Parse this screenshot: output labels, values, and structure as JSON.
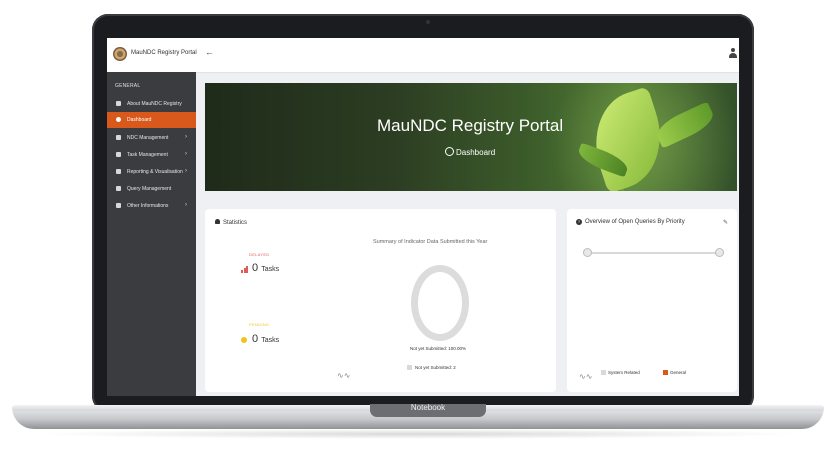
{
  "app": {
    "title": "MauNDC Registry Portal"
  },
  "topbar": {
    "back_icon": "arrow-left-icon",
    "user_icon": "user-icon"
  },
  "sidebar": {
    "section": "GENERAL",
    "items": [
      {
        "label": "About MauNDC Registry",
        "icon": "info-icon",
        "active": false,
        "chevron": ""
      },
      {
        "label": "Dashboard",
        "icon": "dashboard-icon",
        "active": true,
        "chevron": ""
      },
      {
        "label": "NDC Management",
        "icon": "document-icon",
        "active": false,
        "chevron": "›"
      },
      {
        "label": "Task Management",
        "icon": "grid-icon",
        "active": false,
        "chevron": "›"
      },
      {
        "label": "Reporting & Visualisation",
        "icon": "report-icon",
        "active": false,
        "chevron": "›"
      },
      {
        "label": "Query Management",
        "icon": "question-icon",
        "active": false,
        "chevron": ""
      },
      {
        "label": "Other Informations",
        "icon": "gear-icon",
        "active": false,
        "chevron": "›"
      }
    ]
  },
  "banner": {
    "title": "MauNDC Registry Portal",
    "subtitle": "Dashboard"
  },
  "statistics": {
    "title": "Statistics",
    "delayed": {
      "label": "DELAYED",
      "count": "0",
      "unit": "Tasks",
      "color": "#e05a5a"
    },
    "pending": {
      "label": "PENDING",
      "count": "0",
      "unit": "Tasks",
      "color": "#f3c21a"
    },
    "summary_title": "Summary of Indicator Data Submitted this Year",
    "ring_caption": "Not yet Submitted: 100.00%",
    "legend": "Not yet Submitted: 2"
  },
  "queries": {
    "title": "Overview of Open Queries By Priority",
    "legend": [
      {
        "label": "System Related",
        "color": "#d9d9d9"
      },
      {
        "label": "General",
        "color": "#d9581c"
      }
    ]
  },
  "laptop": {
    "label": "Notebook"
  },
  "colors": {
    "accent": "#d9581c",
    "sidebar": "#3a3c3f"
  }
}
